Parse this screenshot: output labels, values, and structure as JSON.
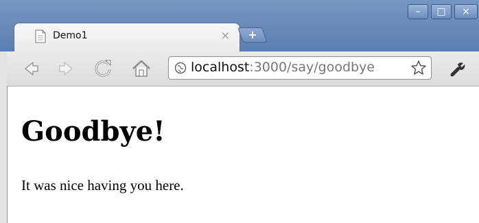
{
  "browser": {
    "tab": {
      "title": "Demo1",
      "close_glyph": "×",
      "icon": "document-icon"
    },
    "new_tab_glyph": "+",
    "window_controls": {
      "minimize": "–",
      "maximize": "□",
      "close": "×"
    },
    "toolbar": {
      "back_icon": "back-arrow-icon",
      "forward_icon": "forward-arrow-icon",
      "reload_icon": "reload-icon",
      "home_icon": "home-icon",
      "wrench_icon": "wrench-icon"
    },
    "address_bar": {
      "host": "localhost",
      "rest": ":3000/say/goodbye",
      "icon": "globe-icon",
      "star_icon": "star-icon"
    }
  },
  "page": {
    "heading": "Goodbye!",
    "paragraph": "It was nice having you here."
  },
  "colors": {
    "titlebar": "#6a8bbb",
    "toolbar": "#e3e3e3"
  }
}
